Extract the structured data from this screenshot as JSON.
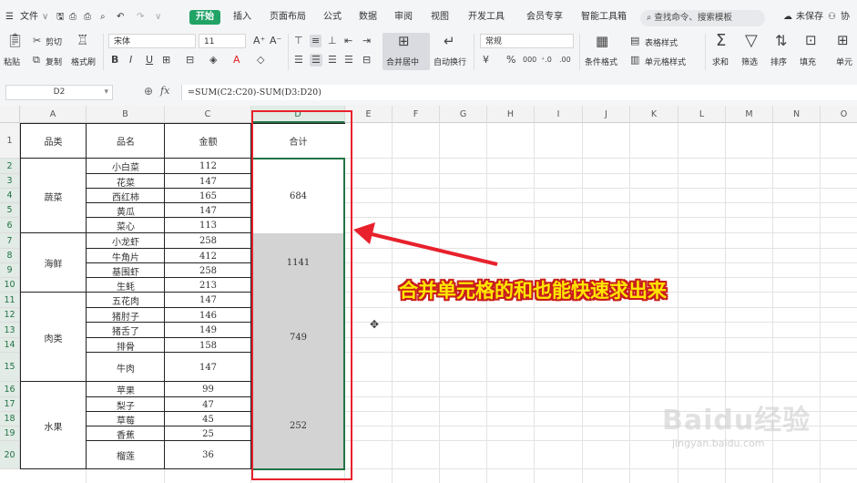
{
  "menu": {
    "items": [
      "文件",
      "开始",
      "插入",
      "页面布局",
      "公式",
      "数据",
      "审阅",
      "视图",
      "开发工具",
      "会员专享",
      "智能工具箱"
    ],
    "active": "开始",
    "search_placeholder": "查找命令、搜索模板",
    "unsaved": "未保存",
    "collab": "协"
  },
  "ribbon": {
    "paste": "粘贴",
    "cut": "剪切",
    "copy": "复制",
    "format_painter": "格式刷",
    "font_name": "宋体",
    "font_size": "11",
    "merge_center": "合并居中",
    "wrap_text": "自动换行",
    "number_format": "常规",
    "conditional_format": "条件格式",
    "table_style": "表格样式",
    "cell_style": "单元格样式",
    "sum": "求和",
    "filter": "筛选",
    "sort": "排序",
    "fill": "填充",
    "cell": "单元"
  },
  "formula_bar": {
    "cell_ref": "D2",
    "fx": "fx",
    "formula": "=SUM(C2:C20)-SUM(D3:D20)"
  },
  "sheet": {
    "columns": [
      "A",
      "B",
      "C",
      "D",
      "E",
      "F",
      "G",
      "H",
      "I",
      "J",
      "K",
      "L",
      "M",
      "N",
      "O"
    ],
    "rows": [
      "1",
      "2",
      "3",
      "4",
      "5",
      "6",
      "7",
      "8",
      "9",
      "10",
      "11",
      "12",
      "13",
      "14",
      "15",
      "16",
      "17",
      "18",
      "19",
      "20"
    ],
    "headers": {
      "category": "品类",
      "item": "品名",
      "amount": "金额",
      "total": "合计"
    },
    "groups": [
      {
        "category": "蔬菜",
        "total": "684",
        "items": [
          {
            "name": "小白菜",
            "amount": "112"
          },
          {
            "name": "花菜",
            "amount": "147"
          },
          {
            "name": "西红柿",
            "amount": "165"
          },
          {
            "name": "黄瓜",
            "amount": "147"
          },
          {
            "name": "菜心",
            "amount": "113"
          }
        ]
      },
      {
        "category": "海鲜",
        "total": "1141",
        "items": [
          {
            "name": "小龙虾",
            "amount": "258"
          },
          {
            "name": "牛角片",
            "amount": "412"
          },
          {
            "name": "基围虾",
            "amount": "258"
          },
          {
            "name": "生蚝",
            "amount": "213"
          }
        ]
      },
      {
        "category": "肉类",
        "total": "749",
        "items": [
          {
            "name": "五花肉",
            "amount": "147"
          },
          {
            "name": "猪肘子",
            "amount": "146"
          },
          {
            "name": "猪舌了",
            "amount": "149"
          },
          {
            "name": "排骨",
            "amount": "158"
          },
          {
            "name": "牛肉",
            "amount": "147"
          }
        ]
      },
      {
        "category": "水果",
        "total": "252",
        "items": [
          {
            "name": "苹果",
            "amount": "99"
          },
          {
            "name": "梨子",
            "amount": "47"
          },
          {
            "name": "草莓",
            "amount": "45"
          },
          {
            "name": "香蕉",
            "amount": "25"
          },
          {
            "name": "榴莲",
            "amount": "36"
          }
        ]
      }
    ]
  },
  "annotation": {
    "caption": "合并单元格的和也能快速求出来",
    "arrow_color": "#e8212c"
  },
  "watermark": {
    "logo": "Baidu经验",
    "url": "jingyan.baidu.com"
  },
  "colors": {
    "accent": "#21a366",
    "selected_fill": "#d3d3d3",
    "selection_border": "#217346"
  }
}
